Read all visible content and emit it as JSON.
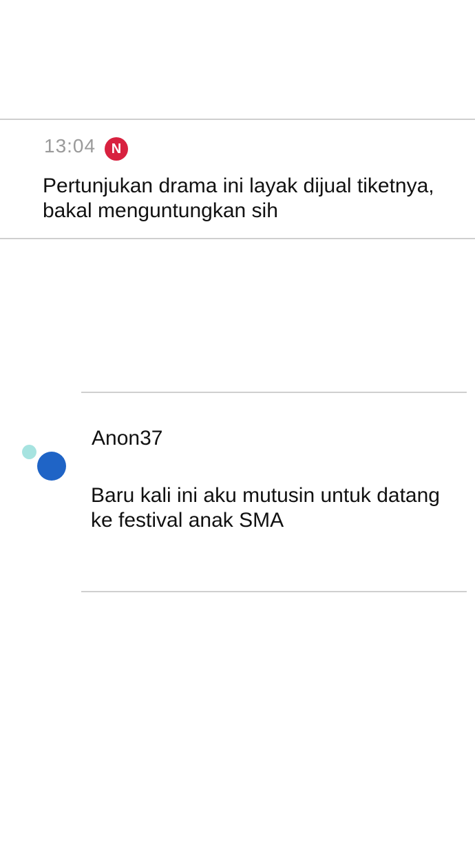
{
  "notification": {
    "time": "13:04",
    "badge": "N",
    "badge_color": "#d8213f",
    "message": "Pertunjukan drama ini layak dijual tiketnya,\nbakal menguntungkan sih"
  },
  "chat": {
    "username": "Anon37",
    "message": "Baru kali ini aku mutusin untuk datang\nke festival anak SMA",
    "avatar_colors": [
      "#a6e3e0",
      "#1f64c6"
    ]
  }
}
